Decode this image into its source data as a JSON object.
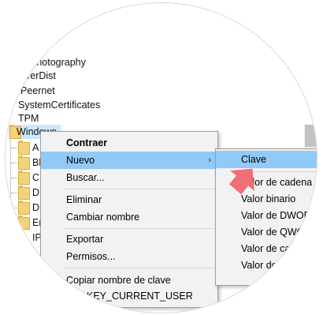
{
  "tree": {
    "items": [
      "Photography",
      "TerDist",
      "Peernet",
      "SystemCertificates",
      "TPM",
      "Windows"
    ],
    "subfolders": [
      "A",
      "Bl",
      "C",
      "D",
      "D",
      "En",
      "IP"
    ]
  },
  "context_menu": {
    "items": [
      "Contraer",
      "Nuevo",
      "Buscar...",
      "Eliminar",
      "Cambiar nombre",
      "Exportar",
      "Permisos...",
      "Copiar nombre de clave",
      "KEY_CURRENT_USER"
    ],
    "submenu_arrow": "›"
  },
  "submenu": {
    "items": [
      "Clave",
      "Valor de cadena",
      "Valor binario",
      "Valor de DWORD",
      "Valor de QWORD",
      "Valor de cadena",
      "Valor de cadena"
    ]
  },
  "colors": {
    "highlight": "#91c9f7",
    "pointer": "#ef6f77",
    "selection": "#cce8ff"
  }
}
